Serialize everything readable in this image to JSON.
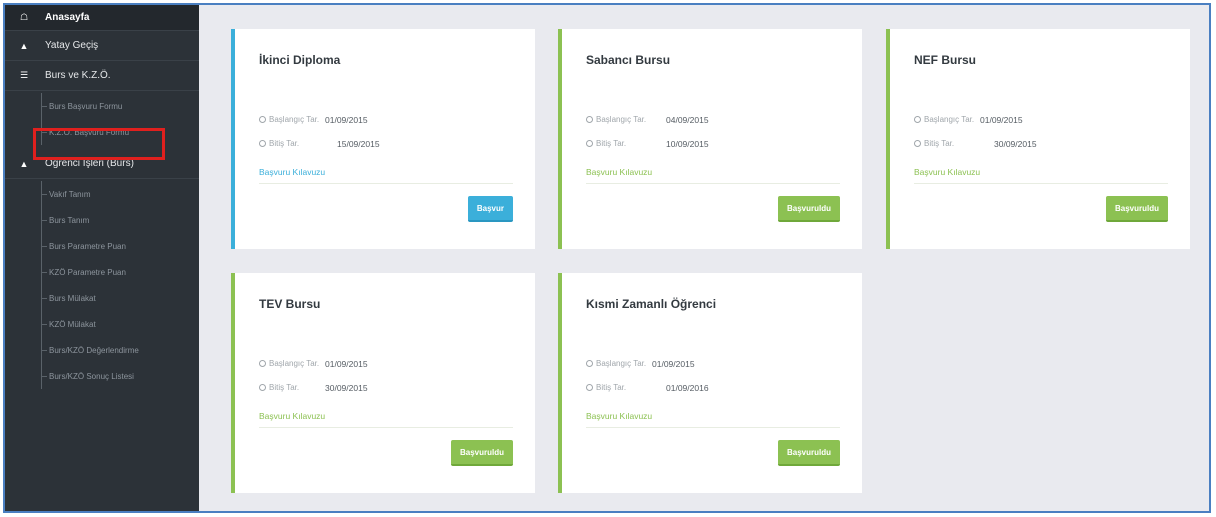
{
  "sidebar": {
    "items": [
      {
        "label": "Anasayfa",
        "icon": "home-icon"
      },
      {
        "label": "Yatay Geçiş",
        "icon": "user-icon"
      },
      {
        "label": "Burs ve K.Z.Ö.",
        "icon": "list-icon"
      },
      {
        "label": "Öğrenci İşleri (Burs)",
        "icon": "user-icon"
      }
    ],
    "burs_sub": [
      "Burs Başvuru Formu",
      "K.Z.Ö. Başvuru Formu"
    ],
    "ogrenci_sub": [
      "Vakıf Tanım",
      "Burs Tanım",
      "Burs Parametre Puan",
      "KZÖ Parametre Puan",
      "Burs Mülakat",
      "KZÖ Mülakat",
      "Burs/KZÖ Değerlendirme",
      "Burs/KZÖ Sonuç Listesi"
    ]
  },
  "labels": {
    "start": "Başlangıç Tar.",
    "end": "Bitiş Tar.",
    "guide": "Başvuru Kılavuzu"
  },
  "cards": [
    {
      "title": "İkinci Diploma",
      "start": "01/09/2015",
      "end": "15/09/2015",
      "button": "Başvur",
      "state": "open"
    },
    {
      "title": "Sabancı Bursu",
      "start": "04/09/2015",
      "end": "10/09/2015",
      "button": "Başvuruldu",
      "state": "applied"
    },
    {
      "title": "NEF Bursu",
      "start": "01/09/2015",
      "end": "30/09/2015",
      "button": "Başvuruldu",
      "state": "applied"
    },
    {
      "title": "TEV Bursu",
      "start": "01/09/2015",
      "end": "30/09/2015",
      "button": "Başvuruldu",
      "state": "applied"
    },
    {
      "title": "Kısmi Zamanlı Öğrenci",
      "start": "01/09/2015",
      "end": "01/09/2016",
      "button": "Başvuruldu",
      "state": "applied"
    }
  ],
  "colors": {
    "sidebar": "#2c3238",
    "accent_blue": "#3bafda",
    "accent_green": "#8cc152",
    "highlight": "#e0201e"
  }
}
